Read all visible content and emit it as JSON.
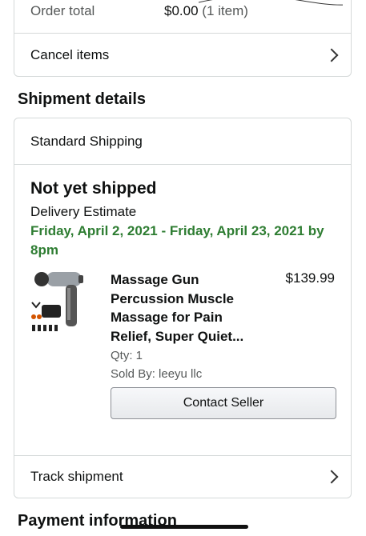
{
  "order_summary": {
    "order_total_label": "Order total",
    "order_total_value": "$0.00",
    "order_item_count": "(1 item)",
    "cancel_items_label": "Cancel items"
  },
  "shipment": {
    "section_title": "Shipment details",
    "shipping_method": "Standard Shipping",
    "status": "Not yet shipped",
    "delivery_estimate_label": "Delivery Estimate",
    "delivery_estimate_dates": "Friday, April 2, 2021 - Friday, April 23, 2021 by 8pm",
    "product": {
      "title": "Massage Gun Percussion Muscle Massage for Pain Relief, Super Quiet...",
      "price": "$139.99",
      "qty": "Qty: 1",
      "sold_by": "Sold By: leeyu llc"
    },
    "contact_seller_label": "Contact Seller",
    "track_shipment_label": "Track shipment"
  },
  "payment": {
    "section_title": "Payment information"
  },
  "colors": {
    "green_estimate": "#2e7d32",
    "border": "#d5d9d9"
  }
}
